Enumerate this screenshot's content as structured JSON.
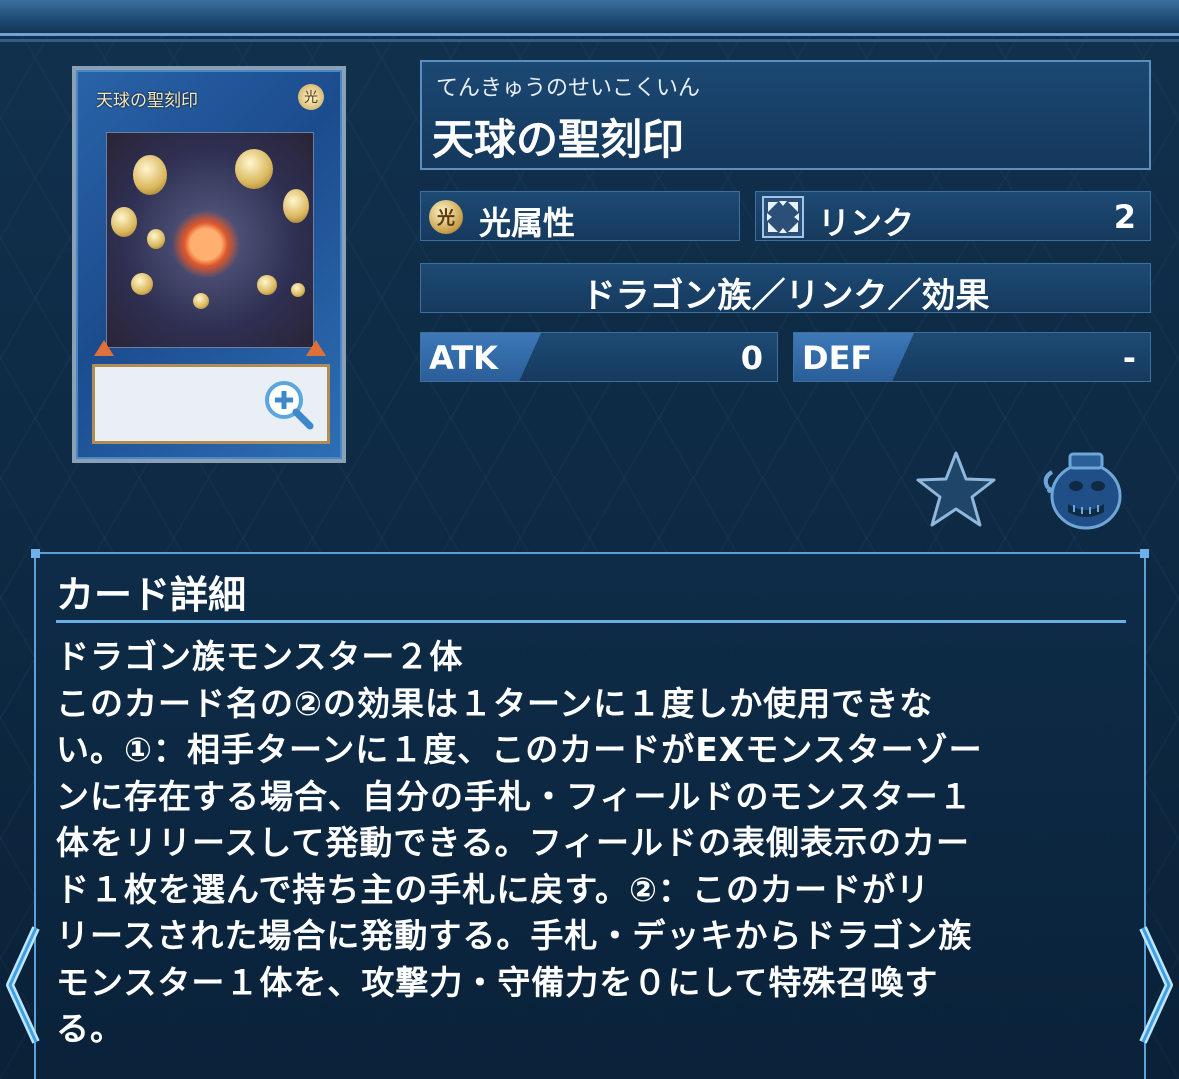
{
  "card": {
    "image_name": "天球の聖刻印",
    "image_attribute_glyph": "光"
  },
  "name": {
    "reading": "てんきゅうのせいこくいん",
    "title": "天球の聖刻印"
  },
  "attribute": {
    "icon_glyph": "光",
    "label": "光属性"
  },
  "link": {
    "label": "リンク",
    "value": "2"
  },
  "type_line": "ドラゴン族／リンク／効果",
  "atk": {
    "label": "ATK",
    "value": "0"
  },
  "def": {
    "label": "DEF",
    "value": "-"
  },
  "detail": {
    "title": "カード詳細",
    "text": "ドラゴン族モンスター２体\nこのカード名の②の効果は１ターンに１度しか使用できな\nい。①：相手ターンに１度、このカードがEXモンスターゾー\nンに存在する場合、自分の手札・フィールドのモンスター１\n体をリリースして発動できる。フィールドの表側表示のカー\nド１枚を選んで持ち主の手札に戻す。②：このカードがリ\nリースされた場合に発動する。手札・デッキからドラゴン族\nモンスター１体を、攻撃力・守備力を０にして特殊召喚す\nる。"
  },
  "icons": {
    "zoom": "zoom-in-icon",
    "favorite": "star-icon",
    "pot": "pot-of-greed-icon",
    "prev": "chevron-left-icon",
    "next": "chevron-right-icon"
  },
  "colors": {
    "background": "#0e2a44",
    "panel_border": "#5ea0d8",
    "tag_blue": "#3d78b8"
  }
}
